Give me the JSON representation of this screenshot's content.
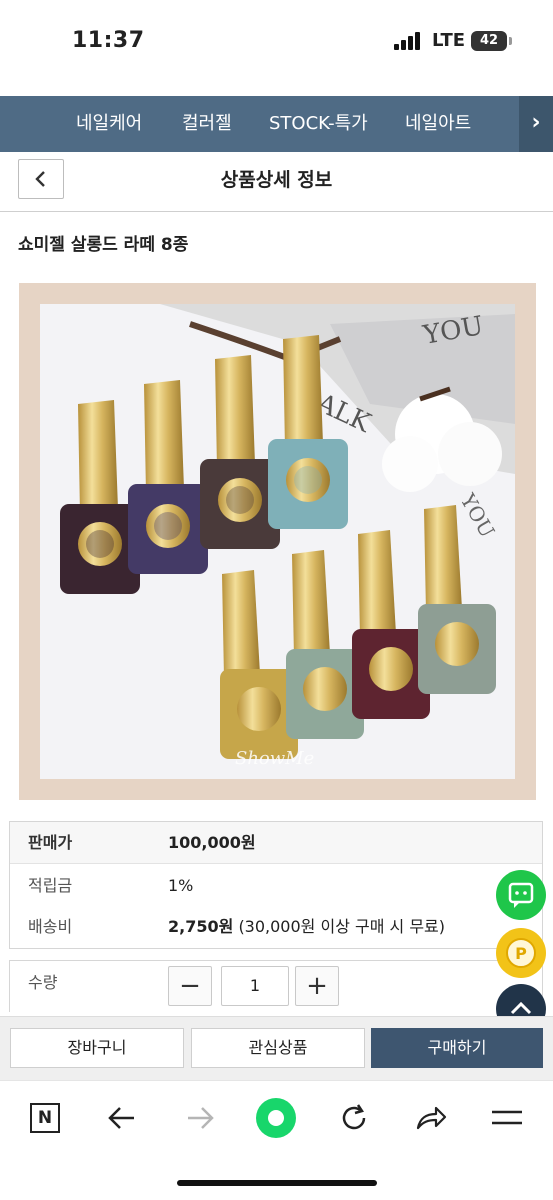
{
  "status": {
    "time": "11:37",
    "network": "LTE",
    "battery": "42"
  },
  "category_nav": {
    "items": [
      "네일케어",
      "컬러젤",
      "STOCK-특가",
      "네일아트"
    ],
    "more_symbol": "›"
  },
  "header": {
    "back_symbol": "‹",
    "title": "상품상세 정보"
  },
  "product": {
    "name": "쇼미젤 살롱드 라떼 8종",
    "photo_text": "ShowMe",
    "photo_bg_text": [
      "YOU",
      "ALK",
      "YOU"
    ]
  },
  "info": {
    "price_label": "판매가",
    "price_value": "100,000원",
    "points_label": "적립금",
    "points_value": "1%",
    "shipping_label": "배송비",
    "shipping_value": "2,750원",
    "shipping_note": "(30,000원 이상 구매 시 무료)"
  },
  "quantity": {
    "label": "수량",
    "minus": "−",
    "plus": "+",
    "value": "1"
  },
  "floating": {
    "point_label": "P"
  },
  "actions": {
    "cart": "장바구니",
    "wishlist": "관심상품",
    "buy": "구매하기"
  },
  "toolbar": {
    "n_label": "N"
  },
  "colors": {
    "nav_bg": "#4f6b85",
    "buy_bg": "#3e5670",
    "talk_green": "#1fc64a",
    "point_yellow": "#f2c318",
    "polish_colors": [
      "#3a2530",
      "#443a66",
      "#4a3a3a",
      "#7fb0b8",
      "#c6a64a",
      "#8fa89a",
      "#5e2430",
      "#8e9e94"
    ]
  }
}
